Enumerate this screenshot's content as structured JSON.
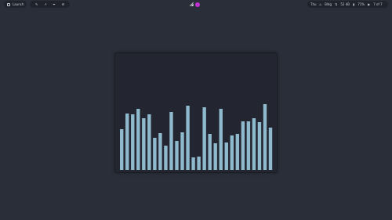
{
  "topbar": {
    "launcher_label": "Launch",
    "workspace_icons": [
      "brush-icon",
      "arrow-icon",
      "pen-icon",
      "gear-icon"
    ],
    "tray": {
      "date": "Thu",
      "location": "Bldg",
      "network": "52 dB",
      "battery": "71%",
      "volume": "7 of 7"
    }
  },
  "visualizer": {
    "bar_color": "#8fb9cc",
    "levels": [
      0.52,
      0.72,
      0.71,
      0.78,
      0.66,
      0.71,
      0.41,
      0.47,
      0.31,
      0.74,
      0.37,
      0.48,
      0.82,
      0.16,
      0.17,
      0.8,
      0.46,
      0.34,
      0.78,
      0.35,
      0.44,
      0.46,
      0.62,
      0.62,
      0.66,
      0.61,
      0.84,
      0.54
    ]
  }
}
